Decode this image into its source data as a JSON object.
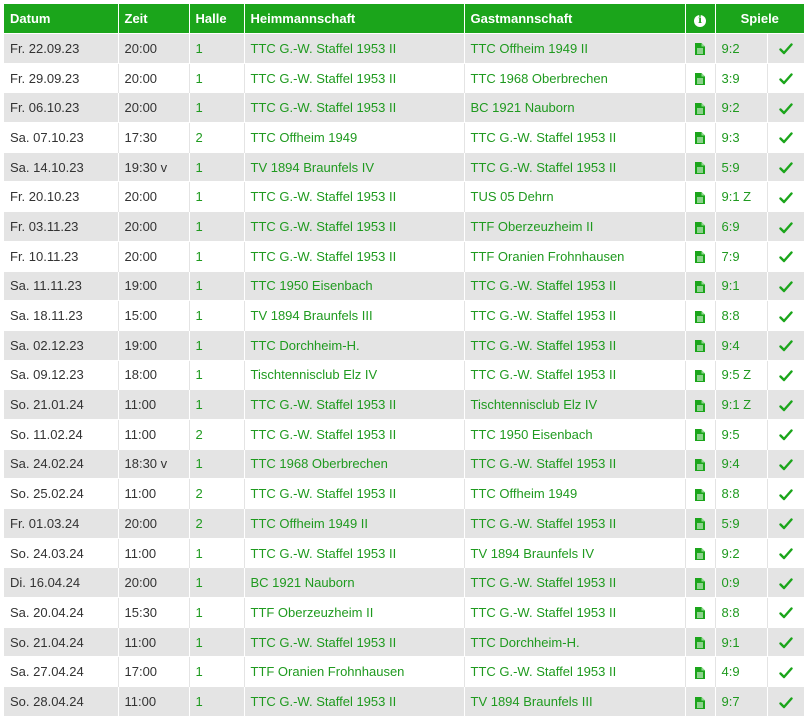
{
  "columns": {
    "datum": "Datum",
    "zeit": "Zeit",
    "halle": "Halle",
    "heim": "Heimmannschaft",
    "gast": "Gastmannschaft",
    "info_icon": "info-icon",
    "spiele": "Spiele"
  },
  "colors": {
    "header_bg": "#1ba51b",
    "link": "#1f9a1f",
    "row_alt": "#e4e4e4"
  },
  "rows": [
    {
      "datum": "Fr. 22.09.23",
      "zeit": "20:00",
      "halle": "1",
      "heim": "TTC G.-W. Staffel 1953 II",
      "gast": "TTC Offheim 1949 II",
      "ergebnis": "9:2"
    },
    {
      "datum": "Fr. 29.09.23",
      "zeit": "20:00",
      "halle": "1",
      "heim": "TTC G.-W. Staffel 1953 II",
      "gast": "TTC 1968 Oberbrechen",
      "ergebnis": "3:9"
    },
    {
      "datum": "Fr. 06.10.23",
      "zeit": "20:00",
      "halle": "1",
      "heim": "TTC G.-W. Staffel 1953 II",
      "gast": "BC 1921 Nauborn",
      "ergebnis": "9:2"
    },
    {
      "datum": "Sa. 07.10.23",
      "zeit": "17:30",
      "halle": "2",
      "heim": "TTC Offheim 1949",
      "gast": "TTC G.-W. Staffel 1953 II",
      "ergebnis": "9:3"
    },
    {
      "datum": "Sa. 14.10.23",
      "zeit": "19:30 v",
      "halle": "1",
      "heim": "TV 1894 Braunfels IV",
      "gast": "TTC G.-W. Staffel 1953 II",
      "ergebnis": "5:9"
    },
    {
      "datum": "Fr. 20.10.23",
      "zeit": "20:00",
      "halle": "1",
      "heim": "TTC G.-W. Staffel 1953 II",
      "gast": "TUS 05 Dehrn",
      "ergebnis": "9:1 Z"
    },
    {
      "datum": "Fr. 03.11.23",
      "zeit": "20:00",
      "halle": "1",
      "heim": "TTC G.-W. Staffel 1953 II",
      "gast": "TTF Oberzeuzheim II",
      "ergebnis": "6:9"
    },
    {
      "datum": "Fr. 10.11.23",
      "zeit": "20:00",
      "halle": "1",
      "heim": "TTC G.-W. Staffel 1953 II",
      "gast": "TTF Oranien Frohnhausen",
      "ergebnis": "7:9"
    },
    {
      "datum": "Sa. 11.11.23",
      "zeit": "19:00",
      "halle": "1",
      "heim": "TTC 1950 Eisenbach",
      "gast": "TTC G.-W. Staffel 1953 II",
      "ergebnis": "9:1"
    },
    {
      "datum": "Sa. 18.11.23",
      "zeit": "15:00",
      "halle": "1",
      "heim": "TV 1894 Braunfels III",
      "gast": "TTC G.-W. Staffel 1953 II",
      "ergebnis": "8:8"
    },
    {
      "datum": "Sa. 02.12.23",
      "zeit": "19:00",
      "halle": "1",
      "heim": "TTC Dorchheim-H.",
      "gast": "TTC G.-W. Staffel 1953 II",
      "ergebnis": "9:4"
    },
    {
      "datum": "Sa. 09.12.23",
      "zeit": "18:00",
      "halle": "1",
      "heim": "Tischtennisclub Elz IV",
      "gast": "TTC G.-W. Staffel 1953 II",
      "ergebnis": "9:5 Z"
    },
    {
      "datum": "So. 21.01.24",
      "zeit": "11:00",
      "halle": "1",
      "heim": "TTC G.-W. Staffel 1953 II",
      "gast": "Tischtennisclub Elz IV",
      "ergebnis": "9:1 Z"
    },
    {
      "datum": "So. 11.02.24",
      "zeit": "11:00",
      "halle": "2",
      "heim": "TTC G.-W. Staffel 1953 II",
      "gast": "TTC 1950 Eisenbach",
      "ergebnis": "9:5"
    },
    {
      "datum": "Sa. 24.02.24",
      "zeit": "18:30 v",
      "halle": "1",
      "heim": "TTC 1968 Oberbrechen",
      "gast": "TTC G.-W. Staffel 1953 II",
      "ergebnis": "9:4"
    },
    {
      "datum": "So. 25.02.24",
      "zeit": "11:00",
      "halle": "2",
      "heim": "TTC G.-W. Staffel 1953 II",
      "gast": "TTC Offheim 1949",
      "ergebnis": "8:8"
    },
    {
      "datum": "Fr. 01.03.24",
      "zeit": "20:00",
      "halle": "2",
      "heim": "TTC Offheim 1949 II",
      "gast": "TTC G.-W. Staffel 1953 II",
      "ergebnis": "5:9"
    },
    {
      "datum": "So. 24.03.24",
      "zeit": "11:00",
      "halle": "1",
      "heim": "TTC G.-W. Staffel 1953 II",
      "gast": "TV 1894 Braunfels IV",
      "ergebnis": "9:2"
    },
    {
      "datum": "Di. 16.04.24",
      "zeit": "20:00",
      "halle": "1",
      "heim": "BC 1921 Nauborn",
      "gast": "TTC G.-W. Staffel 1953 II",
      "ergebnis": "0:9"
    },
    {
      "datum": "Sa. 20.04.24",
      "zeit": "15:30",
      "halle": "1",
      "heim": "TTF Oberzeuzheim II",
      "gast": "TTC G.-W. Staffel 1953 II",
      "ergebnis": "8:8"
    },
    {
      "datum": "So. 21.04.24",
      "zeit": "11:00",
      "halle": "1",
      "heim": "TTC G.-W. Staffel 1953 II",
      "gast": "TTC Dorchheim-H.",
      "ergebnis": "9:1"
    },
    {
      "datum": "Sa. 27.04.24",
      "zeit": "17:00",
      "halle": "1",
      "heim": "TTF Oranien Frohnhausen",
      "gast": "TTC G.-W. Staffel 1953 II",
      "ergebnis": "4:9"
    },
    {
      "datum": "So. 28.04.24",
      "zeit": "11:00",
      "halle": "1",
      "heim": "TTC G.-W. Staffel 1953 II",
      "gast": "TV 1894 Braunfels III",
      "ergebnis": "9:7"
    }
  ]
}
